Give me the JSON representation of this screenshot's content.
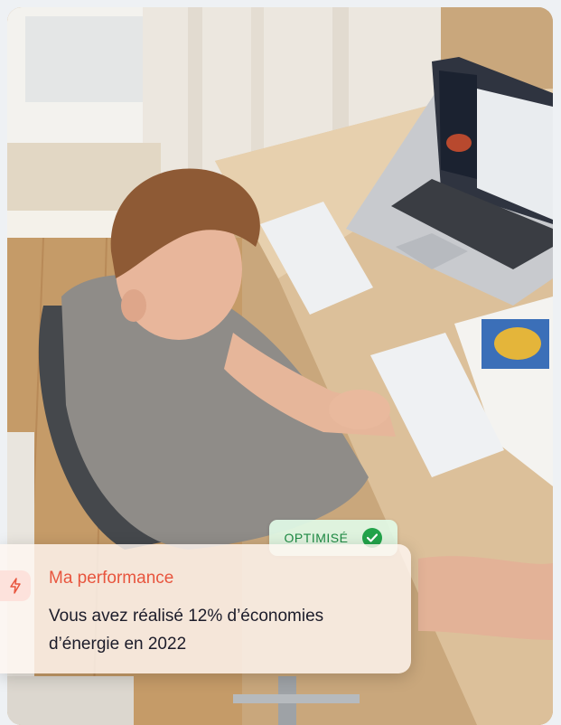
{
  "badge": {
    "label": "OPTIMISÉ",
    "icon": "check-circle-icon",
    "color": "#22a34a"
  },
  "card": {
    "icon": "lightning-bolt-icon",
    "title": "Ma performance",
    "body": "Vous avez réalisé 12% d’économies d’énergie en 2022",
    "accent": "#e8553e"
  },
  "photo": {
    "subject": "man-working-at-desk-photo"
  }
}
